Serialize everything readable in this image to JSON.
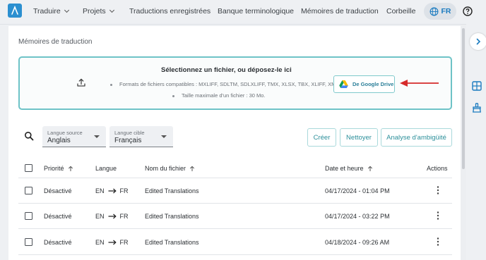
{
  "nav": {
    "items": [
      "Traduire",
      "Projets",
      "Traductions enregistrées",
      "Banque terminologique",
      "Mémoires de traduction",
      "Corbeille"
    ],
    "language": "FR"
  },
  "page": {
    "section_title": "Mémoires de traduction"
  },
  "dropzone": {
    "title": "Sélectionnez un fichier, ou déposez-le ici",
    "formats": "Formats de fichiers compatibles : MXLIFF, SDLTM, SDLXLIFF, TMX, XLSX, TBX, XLIFF, XML.",
    "max_size": "Taille maximale d'un fichier : 30 Mo.",
    "gdrive_label": "De Google Drive"
  },
  "toolbar": {
    "source_label": "Langue source",
    "source_value": "Anglais",
    "target_label": "Langue cible",
    "target_value": "Français",
    "create_label": "Créer",
    "clean_label": "Nettoyer",
    "ambiguity_label": "Analyse d'ambigüité"
  },
  "table": {
    "headers": {
      "priority": "Priorité",
      "language": "Langue",
      "filename": "Nom du fichier",
      "datetime": "Date et heure",
      "actions": "Actions"
    },
    "rows": [
      {
        "priority": "Désactivé",
        "src": "EN",
        "tgt": "FR",
        "filename": "Edited Translations",
        "datetime": "04/17/2024 - 01:04 PM"
      },
      {
        "priority": "Désactivé",
        "src": "EN",
        "tgt": "FR",
        "filename": "Edited Translations",
        "datetime": "04/17/2024 - 03:22 PM"
      },
      {
        "priority": "Désactivé",
        "src": "EN",
        "tgt": "FR",
        "filename": "Edited Translations",
        "datetime": "04/18/2024 - 09:26 AM"
      }
    ]
  },
  "colors": {
    "accent_teal": "#6ec3c7",
    "brand_blue": "#2b8fd0",
    "annotation_red": "#d62a2a"
  },
  "icons": [
    "logo-icon",
    "chevron-down-icon",
    "globe-icon",
    "help-icon",
    "upload-icon",
    "google-drive-icon",
    "search-icon",
    "sort-up-icon",
    "arrow-right-icon",
    "kebab-menu-icon",
    "chevron-right-icon",
    "grid-plus-icon",
    "brush-icon"
  ]
}
